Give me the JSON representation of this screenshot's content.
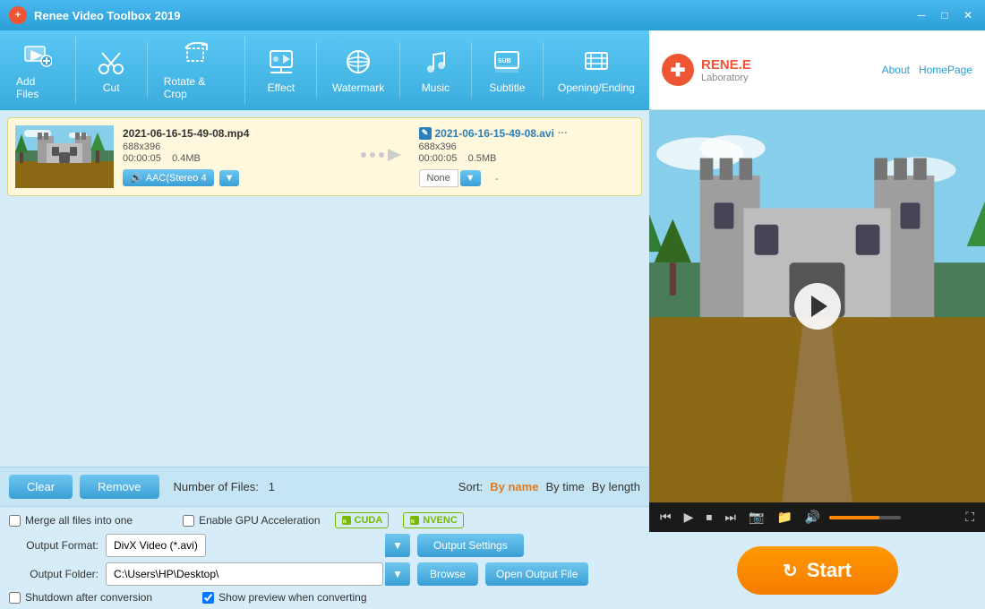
{
  "app": {
    "title": "Renee Video Toolbox 2019",
    "logo_text": "RENE.E",
    "logo_sub": "Laboratory",
    "about_label": "About",
    "homepage_label": "HomePage"
  },
  "toolbar": {
    "items": [
      {
        "id": "add-files",
        "icon": "🎬",
        "label": "Add Files"
      },
      {
        "id": "cut",
        "icon": "✂️",
        "label": "Cut"
      },
      {
        "id": "rotate-crop",
        "icon": "⬜",
        "label": "Rotate & Crop"
      },
      {
        "id": "effect",
        "icon": "🎨",
        "label": "Effect"
      },
      {
        "id": "watermark",
        "icon": "💧",
        "label": "Watermark"
      },
      {
        "id": "music",
        "icon": "🎵",
        "label": "Music"
      },
      {
        "id": "subtitle",
        "icon": "💬",
        "label": "Subtitle"
      },
      {
        "id": "opening-ending",
        "icon": "📋",
        "label": "Opening/Ending"
      }
    ]
  },
  "file_item": {
    "source_name": "2021-06-16-15-49-08.mp4",
    "source_res": "688x396",
    "source_duration": "00:00:05",
    "source_size": "0.4MB",
    "output_name": "2021-06-16-15-49-08.avi",
    "output_res": "688x396",
    "output_duration": "00:00:05",
    "output_size": "0.5MB",
    "audio_label": "AAC(Stereo 4",
    "subtitle_label": "None",
    "output_dash": "-"
  },
  "controls": {
    "clear_label": "Clear",
    "remove_label": "Remove",
    "file_count_prefix": "Number of Files:",
    "file_count": "1",
    "sort_label": "Sort:",
    "sort_by_name": "By name",
    "sort_by_time": "By time",
    "sort_by_length": "By length"
  },
  "settings": {
    "merge_label": "Merge all files into one",
    "gpu_label": "Enable GPU Acceleration",
    "cuda_label": "CUDA",
    "nvenc_label": "NVENC",
    "output_format_label": "Output Format:",
    "output_format_value": "DivX Video (*.avi)",
    "output_settings_label": "Output Settings",
    "output_folder_label": "Output Folder:",
    "output_folder_value": "C:\\Users\\HP\\Desktop\\",
    "browse_label": "Browse",
    "open_output_label": "Open Output File",
    "shutdown_label": "Shutdown after conversion",
    "show_preview_label": "Show preview when converting",
    "show_preview_checked": true
  },
  "video_controls": {
    "prev_icon": "⏮",
    "play_icon": "▶",
    "stop_icon": "⏹",
    "next_icon": "⏭",
    "camera_icon": "📷",
    "folder_icon": "📁",
    "volume_icon": "🔊",
    "expand_icon": "⛶"
  },
  "start": {
    "label": "Start"
  }
}
